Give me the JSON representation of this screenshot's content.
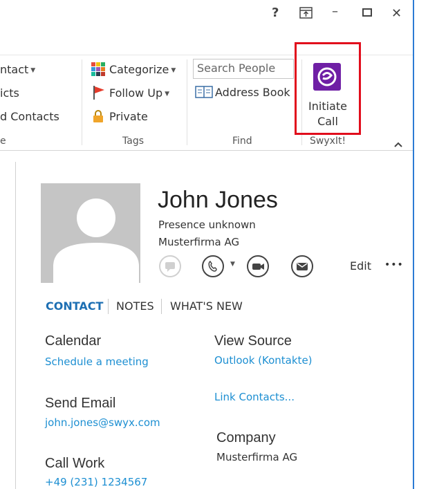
{
  "title_bar": {
    "help_label": "?",
    "ribbon_display_label": "⊞",
    "minimize_label": "–",
    "close_label": "✕"
  },
  "ribbon": {
    "left_partial": {
      "item1": "ntact",
      "item2": "icts",
      "item3": "d Contacts",
      "group_label_fragment": "e"
    },
    "tags": {
      "categorize": "Categorize",
      "follow_up": "Follow Up",
      "private": "Private",
      "group_label": "Tags"
    },
    "find": {
      "search_placeholder": "Search People",
      "address_book": "Address Book",
      "group_label": "Find"
    },
    "swyxit": {
      "initiate_line1": "Initiate",
      "initiate_line2": "Call",
      "group_label": "SwyxIt!"
    },
    "collapse_icon": "chevron-up-icon"
  },
  "contact": {
    "name": "John Jones",
    "presence": "Presence unknown",
    "company_line": "Musterfirma AG",
    "edit_label": "Edit",
    "more_label": "•••",
    "tabs": [
      {
        "label": "CONTACT",
        "active": true
      },
      {
        "label": "NOTES",
        "active": false
      },
      {
        "label": "WHAT'S NEW",
        "active": false
      }
    ],
    "sections": {
      "calendar_title": "Calendar",
      "calendar_link": "Schedule a meeting",
      "view_source_title": "View Source",
      "view_source_link": "Outlook (Kontakte)",
      "link_contacts": "Link Contacts...",
      "send_email_title": "Send Email",
      "email": "john.jones@swyx.com",
      "company_title": "Company",
      "company_value": "Musterfirma AG",
      "call_work_title": "Call Work",
      "phone": "+49 (231) 1234567"
    }
  },
  "colors": {
    "accent_link": "#1d8fd2",
    "highlight_red": "#e10d1c",
    "swyx_purple": "#6f1fa5",
    "window_border": "#2b7bd4"
  }
}
